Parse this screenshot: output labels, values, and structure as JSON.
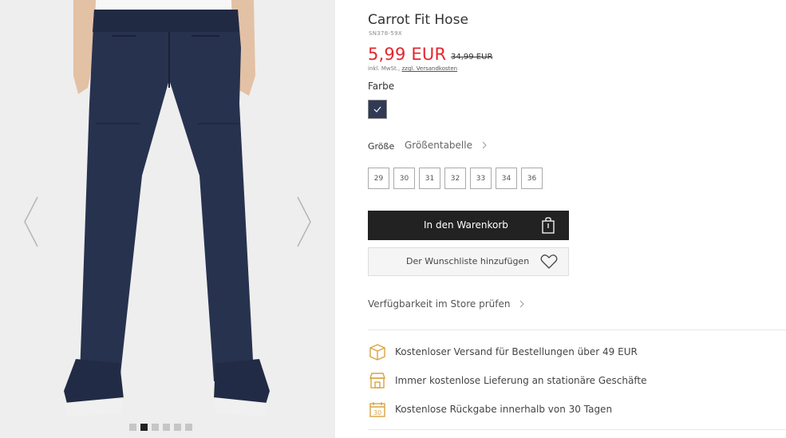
{
  "product": {
    "title": "Carrot Fit Hose",
    "sku": "SN378-59X",
    "price": "5,99 EUR",
    "old_price": "34,99 EUR",
    "tax_prefix": "inkl. MwSt., ",
    "shipping_link": "zzgl. Versandkosten"
  },
  "color": {
    "label": "Farbe",
    "selected_hex": "#303a55"
  },
  "size": {
    "label": "Größe",
    "table_link": "Größentabelle",
    "options": [
      "29",
      "30",
      "31",
      "32",
      "33",
      "34",
      "36"
    ]
  },
  "actions": {
    "cart": "In den Warenkorb",
    "wishlist": "Der Wunschliste hinzufügen",
    "store_check": "Verfügbarkeit im Store prüfen"
  },
  "features": [
    {
      "icon": "box-icon",
      "text": "Kostenloser Versand für Bestellungen über 49 EUR"
    },
    {
      "icon": "store-icon",
      "text": "Immer kostenlose Lieferung an stationäre Geschäfte"
    },
    {
      "icon": "calendar-30-icon",
      "text": "Kostenlose Rückgabe innerhalb von 30 Tagen",
      "badge": "30"
    }
  ],
  "gallery": {
    "image_count": 6,
    "active_index": 2
  },
  "colors": {
    "accent_price": "#e3262c",
    "feature_icon": "#d9a441",
    "button_dark": "#222222"
  }
}
